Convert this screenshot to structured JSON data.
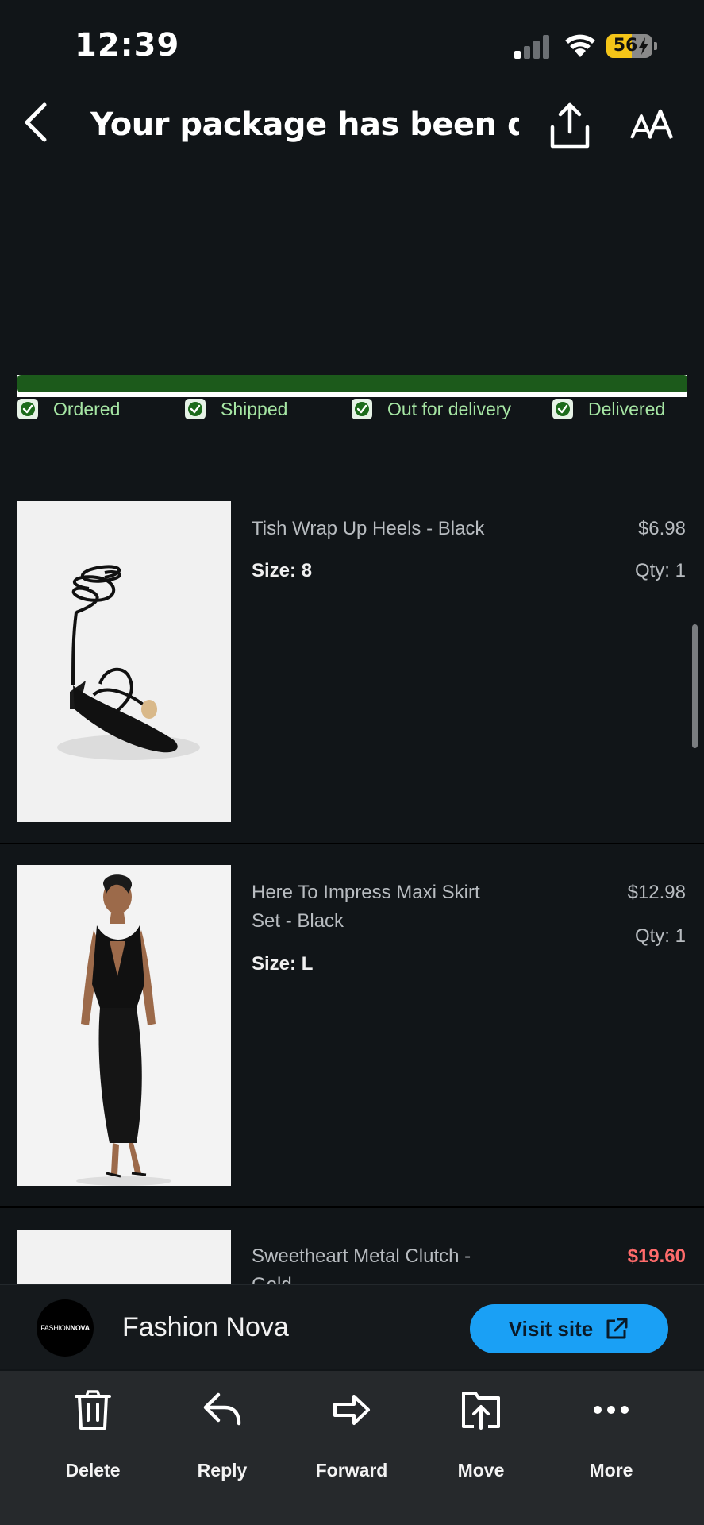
{
  "status_bar": {
    "time": "12:39",
    "battery_percent": "56",
    "battery_level": 0.56
  },
  "header": {
    "title": "Your package has been deli..."
  },
  "tracking": {
    "progress": 1.0,
    "steps": [
      {
        "label": "Ordered",
        "done": true
      },
      {
        "label": "Shipped",
        "done": true
      },
      {
        "label": "Out for delivery",
        "done": true
      },
      {
        "label": "Delivered",
        "done": true
      }
    ]
  },
  "items": [
    {
      "name": "Tish Wrap Up Heels - Black",
      "size_label": "Size:",
      "size": "8",
      "price": "$6.98",
      "qty": "Qty: 1"
    },
    {
      "name": "Here To Impress Maxi Skirt Set - Black",
      "size_label": "Size:",
      "size": "L",
      "price": "$12.98",
      "qty": "Qty: 1"
    },
    {
      "name": "Sweetheart Metal Clutch - Gold",
      "price": "$19.60"
    }
  ],
  "sender": {
    "logo_text_a": "FASHION",
    "logo_text_b": "NOVA",
    "name": "Fashion Nova",
    "visit_label": "Visit site"
  },
  "toolbar": {
    "delete": "Delete",
    "reply": "Reply",
    "forward": "Forward",
    "move": "Move",
    "more": "More"
  },
  "colors": {
    "accent": "#1aa0f5",
    "progress": "#1c5a1b",
    "step_text": "#a6e6a4",
    "sale": "#ff6b6b",
    "background": "#111518"
  }
}
